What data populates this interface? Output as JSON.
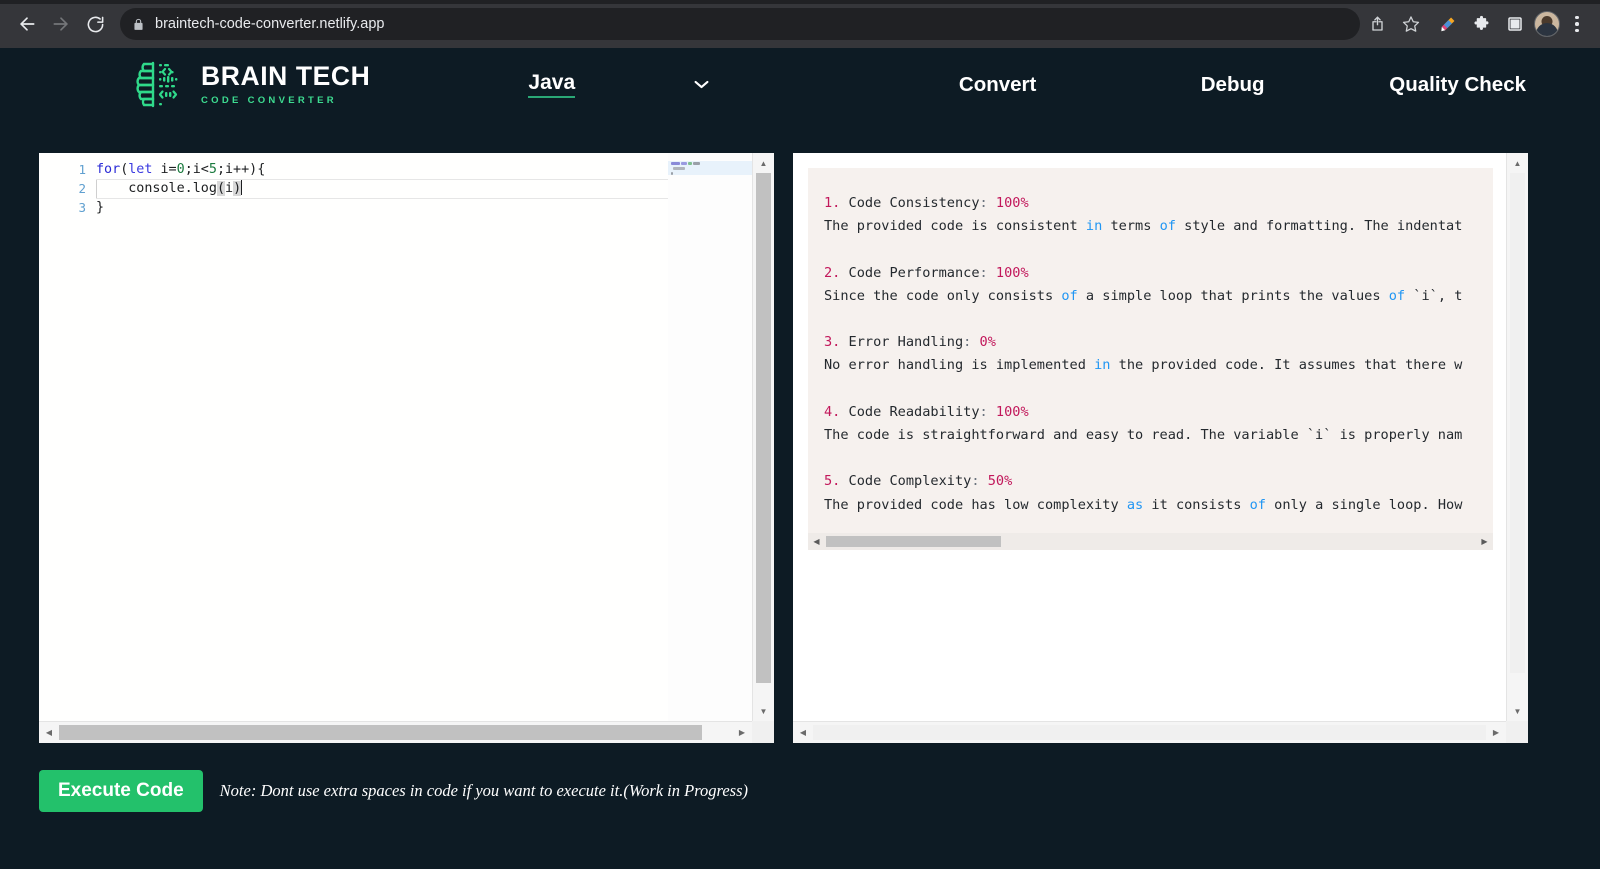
{
  "browser": {
    "url": "braintech-code-converter.netlify.app",
    "back_label": "Back",
    "forward_label": "Forward",
    "reload_label": "Reload",
    "lock_icon": "lock-icon",
    "share_icon": "share-icon",
    "bookmark_icon": "star-icon",
    "highlighter_icon": "highlighter-extension-icon",
    "extensions_icon": "puzzle-piece-icon",
    "sidepanel_icon": "side-panel-icon",
    "profile_icon": "profile-avatar",
    "menu_icon": "three-dot-menu-icon"
  },
  "header": {
    "brand_name": "BRAIN TECH",
    "brand_tagline": "CODE CONVERTER",
    "logo_icon": "brain-circuit-logo",
    "language": "Java",
    "language_chevron_icon": "chevron-down-icon",
    "nav": [
      {
        "label": "Convert"
      },
      {
        "label": "Debug"
      },
      {
        "label": "Quality Check"
      }
    ]
  },
  "editor": {
    "line_numbers": [
      "1",
      "2",
      "3"
    ],
    "lines": [
      {
        "n": "1",
        "text": "for(let i=0;i<5;i++){"
      },
      {
        "n": "2",
        "text": "    console.log(i)"
      },
      {
        "n": "3",
        "text": "}"
      }
    ],
    "tokens": {
      "l1_for": "for",
      "l1_paren_open": "(",
      "l1_let": "let",
      "l1_ivar": " i=",
      "l1_zero": "0",
      "l1_semi1": ";i<",
      "l1_five": "5",
      "l1_rest": ";i++){",
      "l2_indent": "    ",
      "l2_console": "console.log",
      "l2_open": "(",
      "l2_i": "i",
      "l2_close": ")",
      "l3_brace": "}"
    }
  },
  "output": {
    "items": [
      {
        "index": "1.",
        "title": " Code Consistency",
        "colon": ":",
        "score": "100%",
        "body_pre": "The provided code is consistent ",
        "body_kw1": "in",
        "body_mid1": " terms ",
        "body_kw2": "of",
        "body_post": " style and formatting. The indentat"
      },
      {
        "index": "2.",
        "title": " Code Performance",
        "colon": ":",
        "score": "100%",
        "body_pre": "Since the code only consists ",
        "body_kw1": "of",
        "body_mid1": " a simple loop that prints the values ",
        "body_kw2": "of",
        "body_post": " `i`, t"
      },
      {
        "index": "3.",
        "title": " Error Handling",
        "colon": ":",
        "score": "0%",
        "body_pre": "No error handling is implemented ",
        "body_kw1": "in",
        "body_mid1": " the provided code. It assumes that there w",
        "body_kw2": "",
        "body_post": ""
      },
      {
        "index": "4.",
        "title": " Code Readability",
        "colon": ":",
        "score": "100%",
        "body_pre": "The code is straightforward and easy to read. The variable `i` is properly nam",
        "body_kw1": "",
        "body_mid1": "",
        "body_kw2": "",
        "body_post": ""
      },
      {
        "index": "5.",
        "title": " Code Complexity",
        "colon": ":",
        "score": "50%",
        "body_pre": "The provided code has low complexity ",
        "body_kw1": "as",
        "body_mid1": " it consists ",
        "body_kw2": "of",
        "body_post": " only a single loop. How"
      }
    ]
  },
  "footer": {
    "execute_label": "Execute Code",
    "note": "Note: Dont use extra spaces in code if you want to execute it.(Work in Progress)"
  },
  "colors": {
    "page_bg": "#0d1b24",
    "accent_green": "#23c16b",
    "logo_green": "#3ddc91",
    "score_pink": "#c2185b",
    "keyword_blue": "#2196f3"
  }
}
